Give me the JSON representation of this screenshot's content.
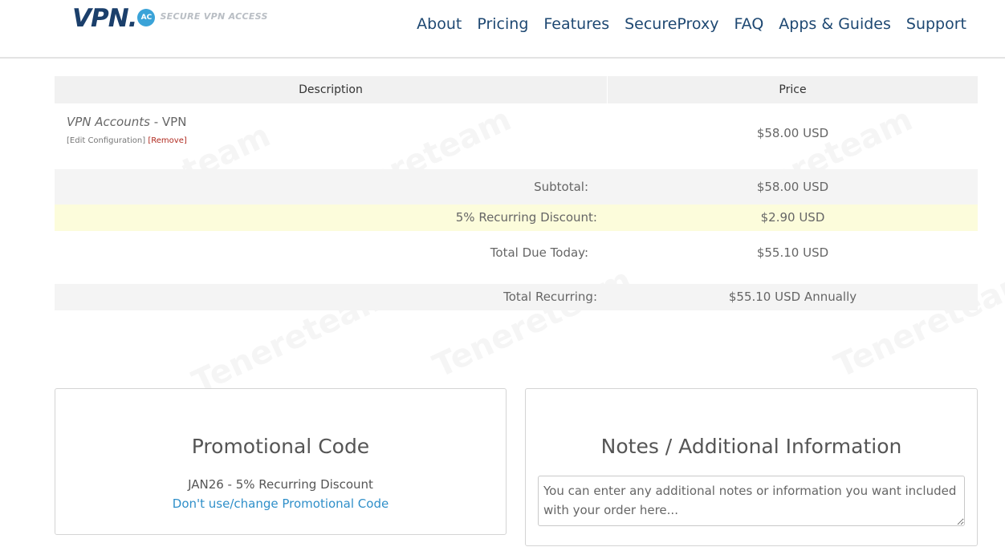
{
  "header": {
    "logo_text": "VPN.",
    "logo_badge": "AC",
    "logo_tagline": "SECURE VPN ACCESS",
    "nav": [
      "About",
      "Pricing",
      "Features",
      "SecureProxy",
      "FAQ",
      "Apps & Guides",
      "Support"
    ]
  },
  "cart": {
    "col_description": "Description",
    "col_price": "Price",
    "item": {
      "group": "VPN Accounts",
      "name": "VPN",
      "edit_label": "[Edit Configuration]",
      "remove_label": "[Remove]",
      "price": "$58.00 USD"
    },
    "subtotal_label": "Subtotal:",
    "subtotal_value": "$58.00 USD",
    "discount_label": "5% Recurring Discount:",
    "discount_value": "$2.90 USD",
    "total_due_label": "Total Due Today:",
    "total_due_value": "$55.10 USD",
    "total_recurring_label": "Total Recurring:",
    "total_recurring_value": "$55.10 USD Annually"
  },
  "promo": {
    "title": "Promotional Code",
    "applied": "JAN26 - 5% Recurring Discount",
    "change_link": "Don't use/change Promotional Code"
  },
  "notes": {
    "title": "Notes / Additional Information",
    "placeholder": "You can enter any additional notes or information you want included with your order here..."
  },
  "watermark": "Tenereteam",
  "colors": {
    "nav": "#1e4872",
    "link": "#2f8fc9",
    "remove": "#b02a1f",
    "discount_bg": "#fcfcdb"
  }
}
